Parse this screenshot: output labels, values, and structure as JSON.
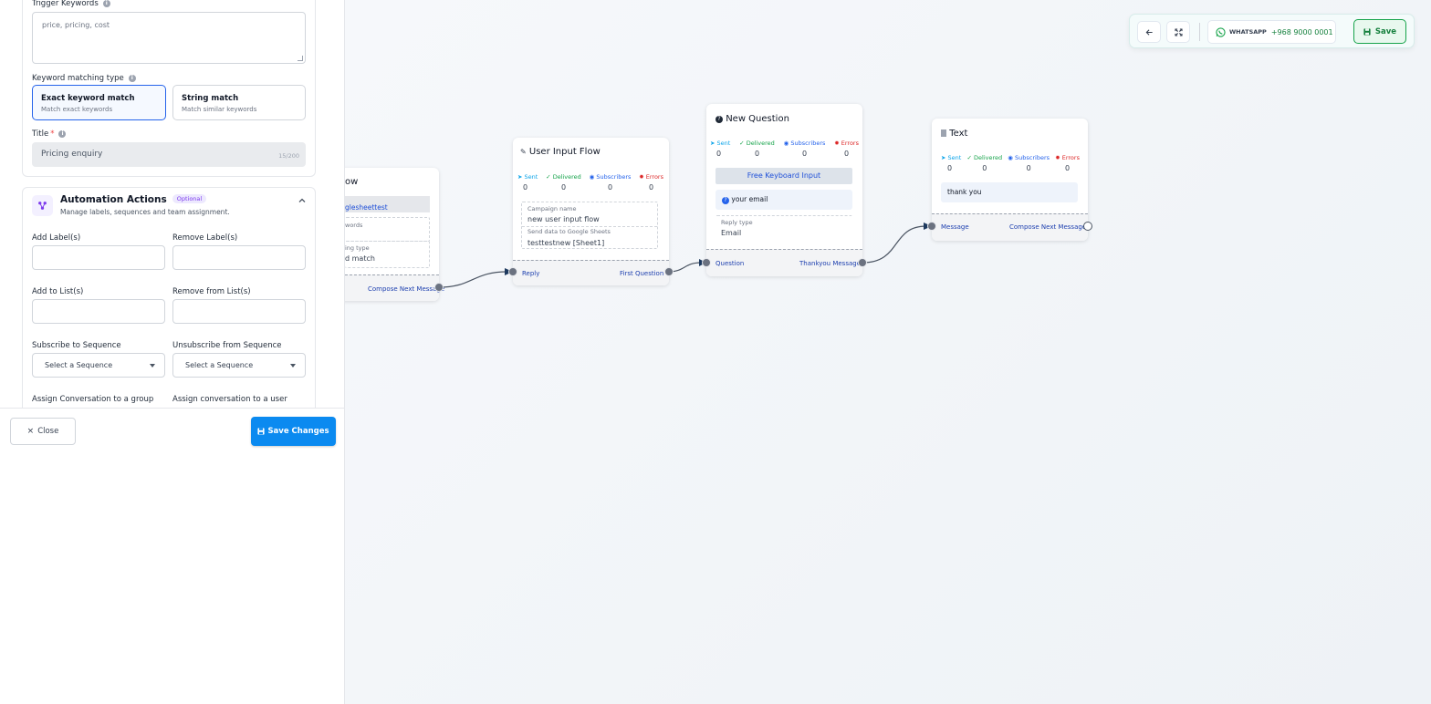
{
  "panel": {
    "trigger_keywords_label": "Trigger Keywords",
    "trigger_keywords_value": "price, pricing, cost",
    "keyword_matching_label": "Keyword matching type",
    "options": [
      {
        "title": "Exact keyword match",
        "subtitle": "Match exact keywords",
        "selected": true
      },
      {
        "title": "String match",
        "subtitle": "Match similar keywords",
        "selected": false
      }
    ],
    "title_label": "Title",
    "title_required": "*",
    "title_value": "Pricing enquiry",
    "title_counter": "15/200",
    "automation": {
      "title": "Automation Actions",
      "badge": "Optional",
      "subtitle": "Manage labels, sequences and team assignment.",
      "add_labels": "Add Label(s)",
      "remove_labels": "Remove Label(s)",
      "add_to_list": "Add to List(s)",
      "remove_from_list": "Remove from List(s)",
      "subscribe_sequence": "Subscribe to Sequence",
      "unsubscribe_sequence": "Unsubscribe from Sequence",
      "sequence_placeholder": "Select a Sequence",
      "assign_group": "Assign Conversation to a group",
      "assign_user": "Assign conversation to a user"
    },
    "close_label": "Close",
    "save_changes_label": "Save Changes"
  },
  "toolbar": {
    "whatsapp_label": "WHATSAPP",
    "whatsapp_number": "+968 9000 0001",
    "save_label": "Save"
  },
  "nodes": {
    "first": {
      "title_fragment": "ow",
      "campaign_fragment": "glesheettest",
      "keywords_fragment": "words",
      "matching_label_fragment": "ing type",
      "matching_value_fragment": "d match",
      "port_out": "Compose Next Message"
    },
    "user_input": {
      "title": "User Input Flow",
      "stats": {
        "sent": "Sent",
        "delivered": "Delivered",
        "subscribers": "Subscribers",
        "errors": "Errors",
        "values": [
          "0",
          "0",
          "0",
          "0"
        ]
      },
      "campaign_label": "Campaign name",
      "campaign_value": "new user input flow",
      "sheets_label": "Send data to Google Sheets",
      "sheets_value": "testtestnew [Sheet1]",
      "port_in": "Reply",
      "port_out": "First Question"
    },
    "question": {
      "title": "New Question",
      "stats": {
        "sent": "Sent",
        "delivered": "Delivered",
        "subscribers": "Subscribers",
        "errors": "Errors",
        "values": [
          "0",
          "0",
          "0",
          "0"
        ]
      },
      "keyboard_label": "Free Keyboard Input",
      "question_text": "your email",
      "reply_type_label": "Reply type",
      "reply_type_value": "Email",
      "port_in": "Question",
      "port_out": "Thankyou Message"
    },
    "text": {
      "title": "Text",
      "stats": {
        "sent": "Sent",
        "delivered": "Delivered",
        "subscribers": "Subscribers",
        "errors": "Errors",
        "values": [
          "0",
          "0",
          "0",
          "0"
        ]
      },
      "message": "thank you",
      "port_in": "Message",
      "port_out": "Compose Next Message"
    }
  },
  "colors": {
    "primary": "#0b8af0",
    "whatsapp": "#16a34a",
    "edge": "#4b5563"
  },
  "icons": [
    "info-icon",
    "automation-icon",
    "chevron-up-icon",
    "close-icon",
    "save-icon",
    "back-arrow-icon",
    "fit-view-icon",
    "whatsapp-icon",
    "send-icon",
    "check-circle-icon",
    "user-circle-icon",
    "error-icon",
    "question-icon",
    "text-icon",
    "input-icon"
  ]
}
